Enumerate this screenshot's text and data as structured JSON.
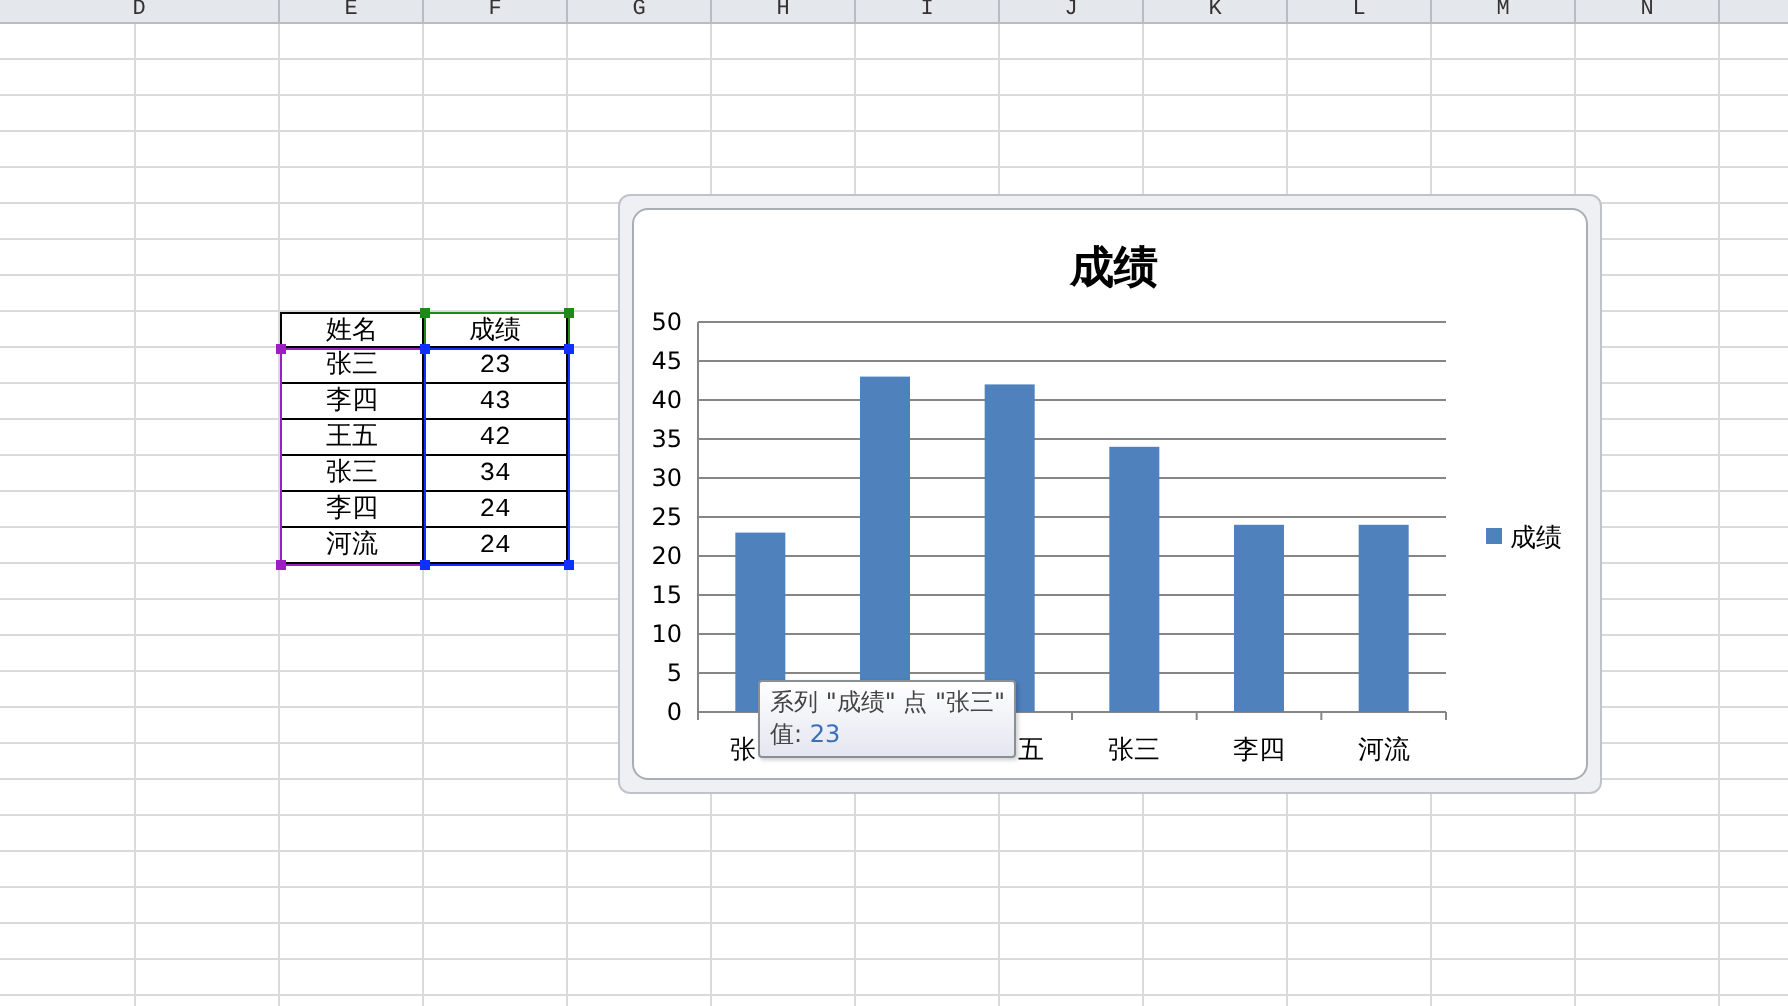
{
  "column_headers": [
    "D",
    "E",
    "F",
    "G",
    "H",
    "I",
    "J",
    "K",
    "L",
    "M",
    "N"
  ],
  "table": {
    "columns": [
      "姓名",
      "成绩"
    ],
    "rows": [
      [
        "张三",
        "23"
      ],
      [
        "李四",
        "43"
      ],
      [
        "王五",
        "42"
      ],
      [
        "张三",
        "34"
      ],
      [
        "李四",
        "24"
      ],
      [
        "河流",
        "24"
      ]
    ]
  },
  "chart": {
    "chart_data": {
      "type": "bar",
      "title": "成绩",
      "categories": [
        "张",
        null,
        "五",
        "张三",
        "李四",
        "河流"
      ],
      "series": [
        {
          "name": "成绩",
          "color": "#4f81bd",
          "values": [
            23,
            43,
            42,
            34,
            24,
            24
          ]
        }
      ],
      "ylim": [
        0,
        50
      ],
      "yticks": [
        0,
        5,
        10,
        15,
        20,
        25,
        30,
        35,
        40,
        45,
        50
      ],
      "grid": true
    }
  },
  "tooltip": {
    "text": "系列 \"成绩\" 点 \"张三\"",
    "label": "值:",
    "value": "23"
  }
}
